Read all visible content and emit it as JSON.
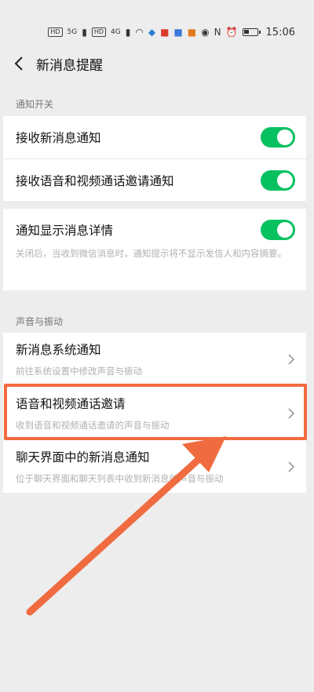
{
  "status_bar": {
    "hd1": "HD",
    "net1": "5G",
    "hd2": "HD",
    "net2": "4G",
    "time": "15:06",
    "battery_level": 0.4
  },
  "header": {
    "title": "新消息提醒",
    "back_icon": "chevron-left-icon"
  },
  "sections": {
    "notify_switch": {
      "header": "通知开关",
      "receive_new_messages": "接收新消息通知",
      "receive_call_invites": "接收语音和视频通话邀请通知",
      "receive_new_messages_on": true,
      "receive_call_invites_on": true
    },
    "details": {
      "label": "通知显示消息详情",
      "on": true,
      "description": "关闭后，当收到微信消息时，通知提示将不显示发信人和内容摘要。"
    },
    "sound_vibration": {
      "header": "声音与振动",
      "items": [
        {
          "label": "新消息系统通知",
          "description": "前往系统设置中修改声音与振动"
        },
        {
          "label": "语音和视频通话邀请",
          "description": "收到语音和视频通话邀请的声音与振动"
        },
        {
          "label": "聊天界面中的新消息通知",
          "description": "位于聊天界面和聊天列表中收到新消息的声音与振动"
        }
      ]
    }
  },
  "colors": {
    "toggle_on": "#07c160",
    "annotation": "#f06b3f",
    "background": "#ededed"
  }
}
